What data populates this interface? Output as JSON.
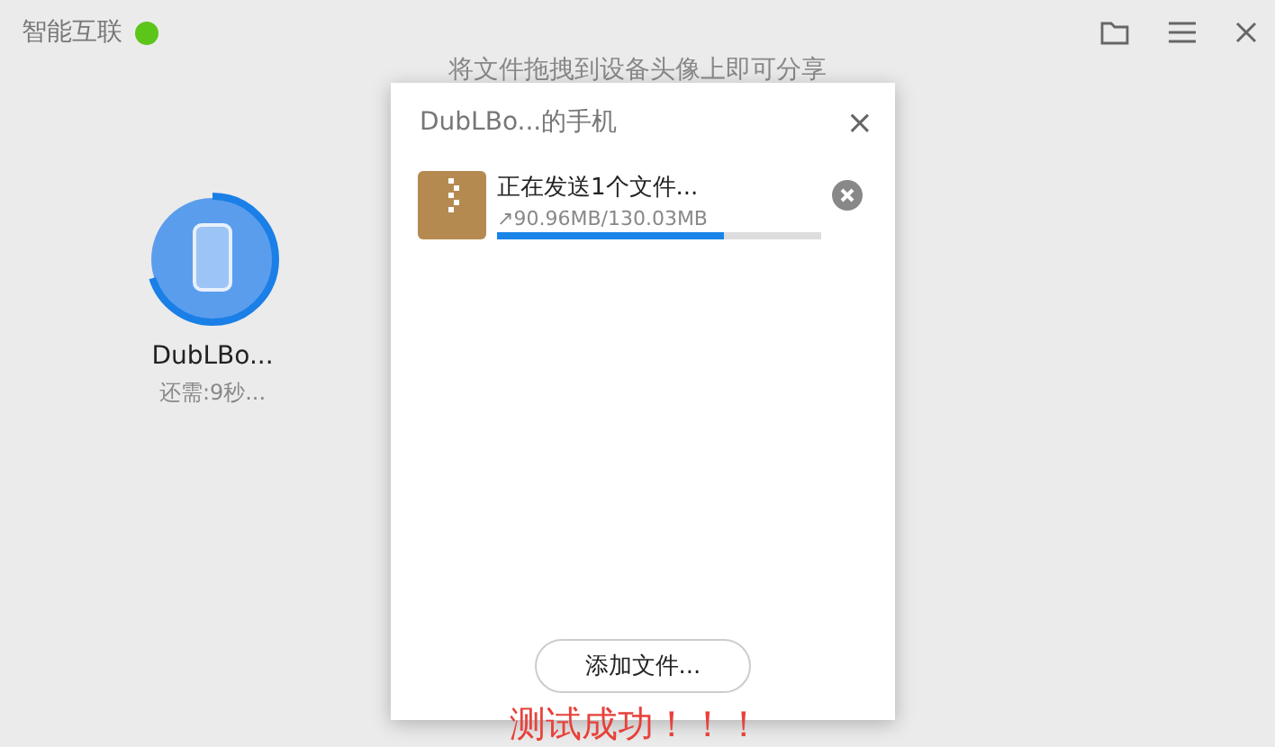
{
  "title_bar": {
    "title": "智能互联",
    "online": true
  },
  "hint": "将文件拖拽到设备头像上即可分享",
  "device": {
    "name": "DubLBo...",
    "status": "还需:9秒...",
    "level": 0.7
  },
  "dialog": {
    "title": "DubLBo...的手机",
    "close": "×",
    "transfer": {
      "title": "正在发送1个文件...",
      "arrow": "↗",
      "progress": "90.96MB/130.03MB",
      "level": 0.7
    },
    "add_button": "添加文件..."
  },
  "message": "测试成功！！！"
}
